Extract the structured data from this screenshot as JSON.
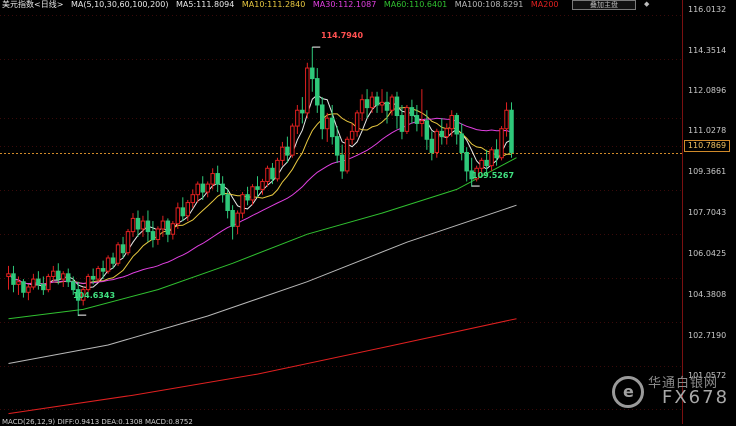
{
  "legend": {
    "title": "美元指数<日线>",
    "ma_header": "MA(5,10,30,60,100,200)",
    "ma_values": [
      {
        "label": "MA5:111.8094",
        "color": "#e8e8e8"
      },
      {
        "label": "MA10:111.2840",
        "color": "#e8c840"
      },
      {
        "label": "MA30:112.1087",
        "color": "#e040e0"
      },
      {
        "label": "MA60:110.6401",
        "color": "#30c030"
      },
      {
        "label": "MA100:108.8291",
        "color": "#b8b8b8"
      },
      {
        "label": "MA200",
        "color": "#e02020"
      }
    ]
  },
  "toolbar": {
    "label": "叠加主盘",
    "arrow": "◆"
  },
  "footer": {
    "text": "MACD(26,12,9)  DIFF:0.9413  DEA:0.1308  MACD:0.8752"
  },
  "logo": {
    "cn": "华通白银网",
    "code": "FX678",
    "icon": "e-logo-icon"
  },
  "colors": {
    "up": "#e02020",
    "down": "#2ec87a",
    "ref_line": "#d08a2a",
    "grid": "#3a0a0a"
  },
  "chart_data": {
    "type": "candlestick",
    "instrument": "美元指数",
    "period": "日线",
    "ylim": [
      101.0,
      116.2
    ],
    "y_ticks": [
      "116.0132",
      "114.3514",
      "112.0896",
      "111.0278",
      "109.3661",
      "107.7043",
      "106.0425",
      "104.3808",
      "102.7190",
      "101.0572"
    ],
    "current_price": "110.7869",
    "annotations": [
      {
        "label": "114.7940",
        "value": 114.794,
        "index": 61,
        "color": "#ff5050"
      },
      {
        "label": "109.5267",
        "value": 109.5267,
        "index": 93,
        "color": "#40e080"
      },
      {
        "label": "104.6343",
        "value": 104.6343,
        "index": 14,
        "color": "#40e080"
      }
    ],
    "candles": [
      [
        106.1,
        106.5,
        106.2,
        105.6
      ],
      [
        106.2,
        106.5,
        105.8,
        105.5
      ],
      [
        105.8,
        106.1,
        105.9,
        105.4
      ],
      [
        105.9,
        106.0,
        105.5,
        105.3
      ],
      [
        105.5,
        105.8,
        105.7,
        105.2
      ],
      [
        105.7,
        106.2,
        106.0,
        105.6
      ],
      [
        106.0,
        106.3,
        105.8,
        105.6
      ],
      [
        105.8,
        106.1,
        105.6,
        105.4
      ],
      [
        105.6,
        106.2,
        106.1,
        105.5
      ],
      [
        106.1,
        106.5,
        106.3,
        105.9
      ],
      [
        106.3,
        106.6,
        106.0,
        105.8
      ],
      [
        106.0,
        106.3,
        106.2,
        105.7
      ],
      [
        106.2,
        106.4,
        105.9,
        105.7
      ],
      [
        105.9,
        106.1,
        105.6,
        105.4
      ],
      [
        105.6,
        105.9,
        105.2,
        104.6
      ],
      [
        105.2,
        105.7,
        105.6,
        105.0
      ],
      [
        105.6,
        106.2,
        106.1,
        105.5
      ],
      [
        106.1,
        106.4,
        106.0,
        105.8
      ],
      [
        106.0,
        106.5,
        106.4,
        105.9
      ],
      [
        106.4,
        106.7,
        106.3,
        106.0
      ],
      [
        106.3,
        106.9,
        106.8,
        106.2
      ],
      [
        106.8,
        107.0,
        106.6,
        106.4
      ],
      [
        106.6,
        107.4,
        107.3,
        106.5
      ],
      [
        107.3,
        107.6,
        107.0,
        106.8
      ],
      [
        107.0,
        107.9,
        107.8,
        106.9
      ],
      [
        107.8,
        108.5,
        108.3,
        107.6
      ],
      [
        108.3,
        108.6,
        107.9,
        107.6
      ],
      [
        107.9,
        108.4,
        108.2,
        107.6
      ],
      [
        108.2,
        108.6,
        107.8,
        107.4
      ],
      [
        107.8,
        108.2,
        107.5,
        107.2
      ],
      [
        107.5,
        108.0,
        107.9,
        107.3
      ],
      [
        107.9,
        108.4,
        108.2,
        107.6
      ],
      [
        108.2,
        108.3,
        107.7,
        107.4
      ],
      [
        107.7,
        108.2,
        108.1,
        107.5
      ],
      [
        108.1,
        108.9,
        108.7,
        107.9
      ],
      [
        108.7,
        109.1,
        108.4,
        108.2
      ],
      [
        108.4,
        109.0,
        108.9,
        108.2
      ],
      [
        108.9,
        109.4,
        109.2,
        108.7
      ],
      [
        109.2,
        109.7,
        109.6,
        108.9
      ],
      [
        109.6,
        109.9,
        109.3,
        109.0
      ],
      [
        109.3,
        109.7,
        109.6,
        109.1
      ],
      [
        109.6,
        110.2,
        110.0,
        109.4
      ],
      [
        110.0,
        110.3,
        109.6,
        109.3
      ],
      [
        109.6,
        109.9,
        109.2,
        108.9
      ],
      [
        109.2,
        109.4,
        108.6,
        108.3
      ],
      [
        108.6,
        108.8,
        108.0,
        107.5
      ],
      [
        108.0,
        108.6,
        108.5,
        107.7
      ],
      [
        108.5,
        109.3,
        109.2,
        108.3
      ],
      [
        109.2,
        109.5,
        109.0,
        108.8
      ],
      [
        109.0,
        109.6,
        109.5,
        108.8
      ],
      [
        109.5,
        109.9,
        109.4,
        109.1
      ],
      [
        109.4,
        109.8,
        109.7,
        109.2
      ],
      [
        109.7,
        110.3,
        110.2,
        109.5
      ],
      [
        110.2,
        110.4,
        109.8,
        109.6
      ],
      [
        109.8,
        110.6,
        110.5,
        109.7
      ],
      [
        110.5,
        111.2,
        111.0,
        110.3
      ],
      [
        111.0,
        111.4,
        110.7,
        110.4
      ],
      [
        110.7,
        111.9,
        111.8,
        110.6
      ],
      [
        111.8,
        112.6,
        112.4,
        111.5
      ],
      [
        112.4,
        112.9,
        112.3,
        111.9
      ],
      [
        112.3,
        114.2,
        114.0,
        112.1
      ],
      [
        114.0,
        114.8,
        113.6,
        113.1
      ],
      [
        113.6,
        114.0,
        112.6,
        112.3
      ],
      [
        112.6,
        112.9,
        111.7,
        111.3
      ],
      [
        111.7,
        112.3,
        112.1,
        111.2
      ],
      [
        112.1,
        112.6,
        111.4,
        111.1
      ],
      [
        111.4,
        111.8,
        110.7,
        110.4
      ],
      [
        110.7,
        111.1,
        110.1,
        109.8
      ],
      [
        110.1,
        111.4,
        111.3,
        110.0
      ],
      [
        111.3,
        111.9,
        111.6,
        111.1
      ],
      [
        111.6,
        112.4,
        112.3,
        111.4
      ],
      [
        112.3,
        113.0,
        112.8,
        112.0
      ],
      [
        112.8,
        113.2,
        112.5,
        112.1
      ],
      [
        112.5,
        113.1,
        112.9,
        112.3
      ],
      [
        112.9,
        113.1,
        112.6,
        112.3
      ],
      [
        112.6,
        113.2,
        112.7,
        112.3
      ],
      [
        112.7,
        113.1,
        112.4,
        111.9
      ],
      [
        112.4,
        113.0,
        112.9,
        112.2
      ],
      [
        112.9,
        113.1,
        112.2,
        111.7
      ],
      [
        112.2,
        112.6,
        111.6,
        111.3
      ],
      [
        111.6,
        112.6,
        112.5,
        111.5
      ],
      [
        112.5,
        112.8,
        112.2,
        111.9
      ],
      [
        112.2,
        112.6,
        111.9,
        111.6
      ],
      [
        111.9,
        113.2,
        112.0,
        111.4
      ],
      [
        112.0,
        112.4,
        111.3,
        110.9
      ],
      [
        111.3,
        111.6,
        110.8,
        110.5
      ],
      [
        110.8,
        111.7,
        111.6,
        110.6
      ],
      [
        111.6,
        112.1,
        111.4,
        111.1
      ],
      [
        111.4,
        111.9,
        111.7,
        111.1
      ],
      [
        111.7,
        112.4,
        112.2,
        111.4
      ],
      [
        112.2,
        112.3,
        111.5,
        111.1
      ],
      [
        111.5,
        111.9,
        110.8,
        110.5
      ],
      [
        110.8,
        111.0,
        110.1,
        109.7
      ],
      [
        110.1,
        110.6,
        109.8,
        109.5
      ],
      [
        109.8,
        110.3,
        110.2,
        109.7
      ],
      [
        110.2,
        110.6,
        110.5,
        110.0
      ],
      [
        110.5,
        110.9,
        110.3,
        110.0
      ],
      [
        110.3,
        111.0,
        110.9,
        110.1
      ],
      [
        110.9,
        111.3,
        110.6,
        110.3
      ],
      [
        110.6,
        111.8,
        111.7,
        110.5
      ],
      [
        111.7,
        112.7,
        112.4,
        111.4
      ],
      [
        112.4,
        112.7,
        110.8,
        110.6
      ]
    ],
    "ma_series": [
      {
        "label": "MA5",
        "period": 5,
        "color": "#e8e8e8"
      },
      {
        "label": "MA10",
        "period": 10,
        "color": "#e8c840"
      },
      {
        "label": "MA30",
        "period": 30,
        "color": "#e040e0"
      },
      {
        "label": "MA60",
        "period": 60,
        "color": "#30c030"
      },
      {
        "label": "MA100",
        "period": 100,
        "color": "#b8b8b8"
      },
      {
        "label": "MA200",
        "period": 200,
        "color": "#e02020"
      }
    ],
    "long_ma_estimates": {
      "MA60": [
        [
          0,
          104.5
        ],
        [
          15,
          104.85
        ],
        [
          30,
          105.6
        ],
        [
          45,
          106.6
        ],
        [
          60,
          107.7
        ],
        [
          75,
          108.5
        ],
        [
          90,
          109.4
        ],
        [
          102,
          110.6
        ]
      ],
      "MA100": [
        [
          0,
          102.8
        ],
        [
          20,
          103.5
        ],
        [
          40,
          104.6
        ],
        [
          60,
          105.9
        ],
        [
          80,
          107.4
        ],
        [
          102,
          108.8
        ]
      ],
      "MA200": [
        [
          0,
          100.9
        ],
        [
          25,
          101.6
        ],
        [
          50,
          102.4
        ],
        [
          75,
          103.4
        ],
        [
          102,
          104.5
        ]
      ]
    }
  }
}
